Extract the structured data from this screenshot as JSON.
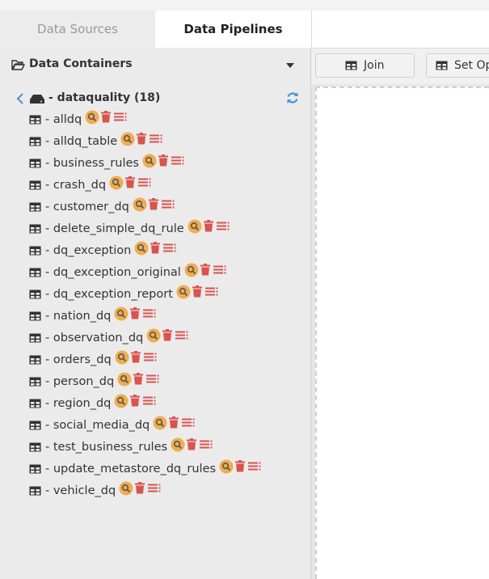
{
  "tabs": {
    "data_sources": "Data Sources",
    "data_pipelines": "Data Pipelines"
  },
  "sidebar": {
    "title": "Data Containers",
    "group": {
      "label": "- dataquality (18)"
    },
    "tables": [
      "- alldq",
      "- alldq_table",
      "- business_rules",
      "- crash_dq",
      "- customer_dq",
      "- delete_simple_dq_rule",
      "- dq_exception",
      "- dq_exception_original",
      "- dq_exception_report",
      "- nation_dq",
      "- observation_dq",
      "- orders_dq",
      "- person_dq",
      "- region_dq",
      "- social_media_dq",
      "- test_business_rules",
      "- update_metastore_dq_rules",
      "- vehicle_dq"
    ]
  },
  "toolbar": {
    "join": "Join",
    "set_op": "Set Op"
  },
  "colors": {
    "accent_blue": "#4a90d9",
    "delete_red": "#d9534f",
    "search_orange": "#f0ad4e"
  }
}
